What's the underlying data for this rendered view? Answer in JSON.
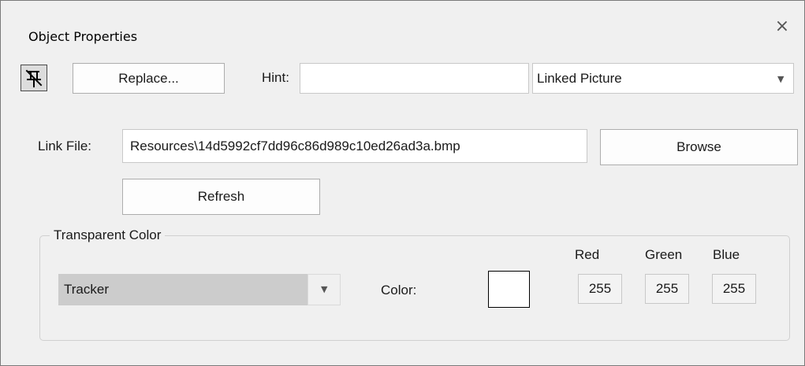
{
  "window": {
    "title": "Object Properties",
    "close_glyph": "×"
  },
  "toolbar": {
    "pin_icon": "pin-icon",
    "replace_label": "Replace...",
    "hint_label": "Hint:",
    "hint_value": "",
    "type_value": "Linked Picture"
  },
  "link": {
    "label": "Link File:",
    "value": "Resources\\14d5992cf7dd96c86d989c10ed26ad3a.bmp",
    "browse_label": "Browse",
    "refresh_label": "Refresh"
  },
  "transparent": {
    "group_label": "Transparent Color",
    "mode_value": "Tracker",
    "color_label": "Color:",
    "swatch_color": "#ffffff",
    "red_label": "Red",
    "green_label": "Green",
    "blue_label": "Blue",
    "red_value": "255",
    "green_value": "255",
    "blue_value": "255"
  }
}
